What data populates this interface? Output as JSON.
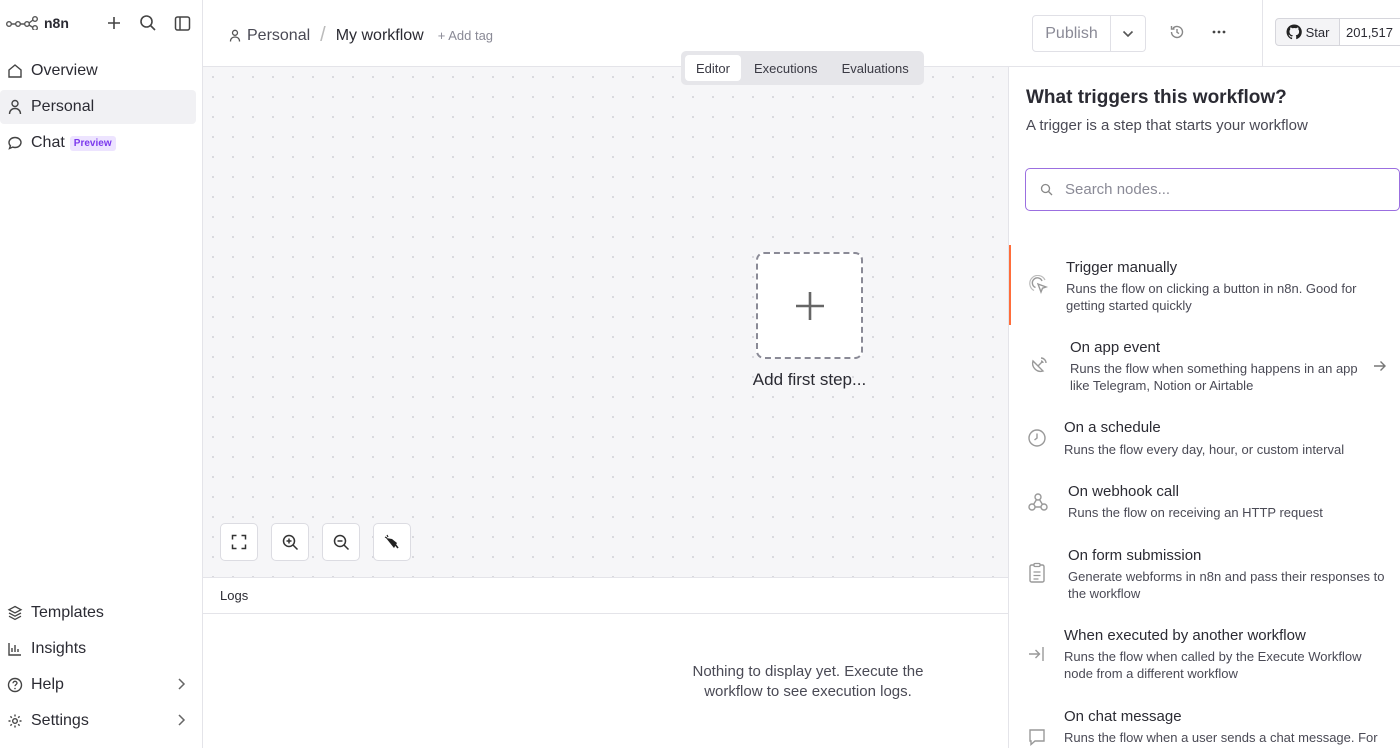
{
  "sidebar": {
    "logo": "n8n",
    "nav": [
      {
        "label": "Overview"
      },
      {
        "label": "Personal"
      },
      {
        "label": "Chat",
        "badge": "Preview"
      }
    ],
    "bottom": [
      {
        "label": "Templates"
      },
      {
        "label": "Insights"
      },
      {
        "label": "Help"
      },
      {
        "label": "Settings"
      }
    ]
  },
  "header": {
    "project": "Personal",
    "separator": "/",
    "workflow_name": "My workflow",
    "add_tag": "+ Add tag",
    "publish": "Publish",
    "github_star": "Star",
    "github_count": "201,517"
  },
  "tabs": [
    "Editor",
    "Executions",
    "Evaluations"
  ],
  "canvas": {
    "add_first_step": "Add first step..."
  },
  "logs": {
    "title": "Logs",
    "empty": "Nothing to display yet. Execute the workflow to see execution logs."
  },
  "panel": {
    "title": "What triggers this workflow?",
    "subtitle": "A trigger is a step that starts your workflow",
    "search_placeholder": "Search nodes...",
    "triggers": [
      {
        "title": "Trigger manually",
        "desc": "Runs the flow on clicking a button in n8n. Good for getting started quickly",
        "icon": "cursor-click-icon"
      },
      {
        "title": "On app event",
        "desc": "Runs the flow when something happens in an app like Telegram, Notion or Airtable",
        "icon": "satellite-dish-icon"
      },
      {
        "title": "On a schedule",
        "desc": "Runs the flow every day, hour, or custom interval",
        "icon": "clock-icon"
      },
      {
        "title": "On webhook call",
        "desc": "Runs the flow on receiving an HTTP request",
        "icon": "webhook-icon"
      },
      {
        "title": "On form submission",
        "desc": "Generate webforms in n8n and pass their responses to the workflow",
        "icon": "clipboard-icon"
      },
      {
        "title": "When executed by another workflow",
        "desc": "Runs the flow when called by the Execute Workflow node from a different workflow",
        "icon": "sign-in-icon"
      },
      {
        "title": "On chat message",
        "desc": "Runs the flow when a user sends a chat message. For",
        "icon": "chat-bubble-icon"
      }
    ]
  },
  "colors": {
    "accent_purple": "#9b6fe0",
    "selected_orange": "#ff6d3a"
  }
}
